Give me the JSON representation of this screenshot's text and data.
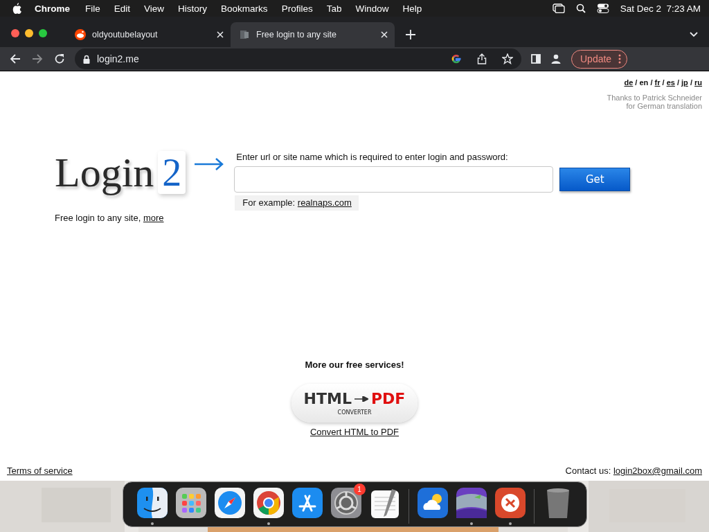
{
  "menu_bar": {
    "app": "Chrome",
    "items": [
      "File",
      "Edit",
      "View",
      "History",
      "Bookmarks",
      "Profiles",
      "Tab",
      "Window",
      "Help"
    ],
    "clock": "Sat Dec 2  7:23 AM"
  },
  "tabs": [
    {
      "title": "oldyoutubelayout",
      "selected": false,
      "kind": "circle"
    },
    {
      "title": "Free login to any site",
      "selected": true,
      "kind": "doc"
    }
  ],
  "toolbar": {
    "nav": [
      {
        "kind": "back",
        "disabled": false
      },
      {
        "kind": "forward",
        "disabled": true
      },
      {
        "kind": "reload",
        "disabled": false
      }
    ],
    "url": "login2.me",
    "update_label": "Update"
  },
  "page": {
    "languages": [
      {
        "code": "de",
        "link": true
      },
      {
        "code": "en",
        "link": false
      },
      {
        "code": "fr",
        "link": true
      },
      {
        "code": "es",
        "link": true
      },
      {
        "code": "jp",
        "link": true
      },
      {
        "code": "ru",
        "link": true
      }
    ],
    "language_separator": "/",
    "credit": [
      "Thanks to Patrick Schneider",
      "for German translation"
    ],
    "logo": {
      "word": "Login",
      "digit": "2"
    },
    "tagline": "Free login to any site,",
    "tagline_link": "more",
    "url_label": "Enter url or site name which is required to enter login and password:",
    "get_button": "Get",
    "example_label": "For example:",
    "example_link": "realnaps.com",
    "services_heading": "More our free services!",
    "service_logo": {
      "left": "HTML",
      "right": "PDF",
      "sub": "CONVERTER"
    },
    "service_link": "Convert HTML to PDF",
    "footer": {
      "terms": "Terms of service",
      "contact_label": "Contact us:",
      "contact_email": "login2box@gmail.com"
    }
  },
  "dock": [
    [
      {
        "kind": "finder",
        "running": true
      },
      {
        "kind": "launchpad",
        "running": false
      },
      {
        "kind": "safari",
        "running": false
      },
      {
        "kind": "chrome",
        "running": true
      },
      {
        "kind": "appstore",
        "running": false
      },
      {
        "kind": "settings",
        "running": false,
        "badge": "1"
      },
      {
        "kind": "textedit",
        "running": false
      }
    ],
    [
      {
        "kind": "weather",
        "running": false
      },
      {
        "kind": "purple",
        "running": true
      },
      {
        "kind": "remote",
        "running": true
      }
    ],
    [
      {
        "kind": "trash",
        "running": false
      }
    ]
  ]
}
